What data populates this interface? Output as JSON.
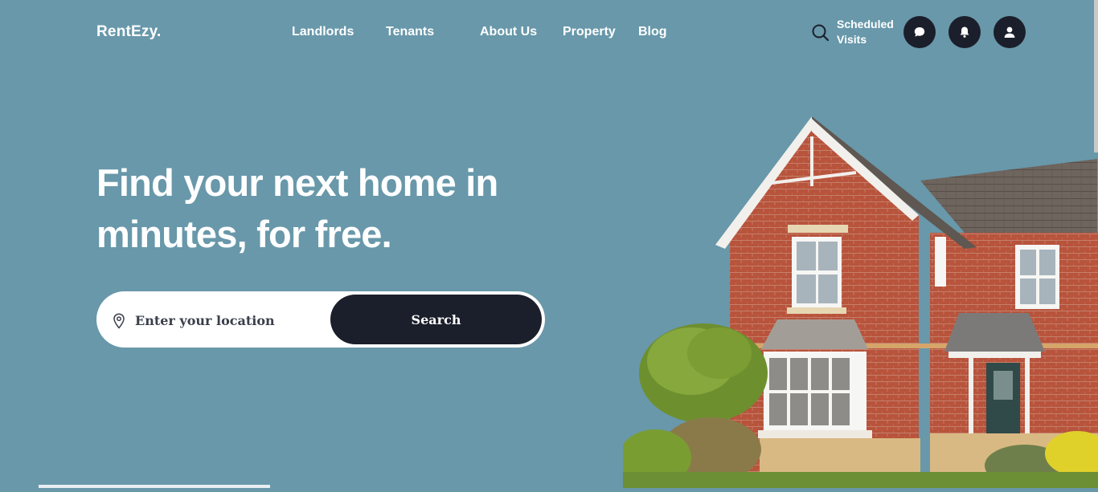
{
  "brand": {
    "name": "RentEzy."
  },
  "nav": {
    "items": [
      {
        "label": "Landlords"
      },
      {
        "label": "Tenants"
      },
      {
        "label": "About Us"
      },
      {
        "label": "Property"
      },
      {
        "label": "Blog"
      }
    ]
  },
  "header": {
    "scheduled_line1": "Scheduled",
    "scheduled_line2": "Visits",
    "icons": [
      "search-icon",
      "chat-icon",
      "bell-icon",
      "user-icon"
    ]
  },
  "hero": {
    "title_line1": "Find your next home in",
    "title_line2": "minutes, for free."
  },
  "search": {
    "placeholder": "Enter your location",
    "value": "",
    "button_label": "Search"
  },
  "colors": {
    "background": "#6898aa",
    "dark": "#1b1f2b",
    "white": "#ffffff",
    "brick": "#b3503a"
  }
}
